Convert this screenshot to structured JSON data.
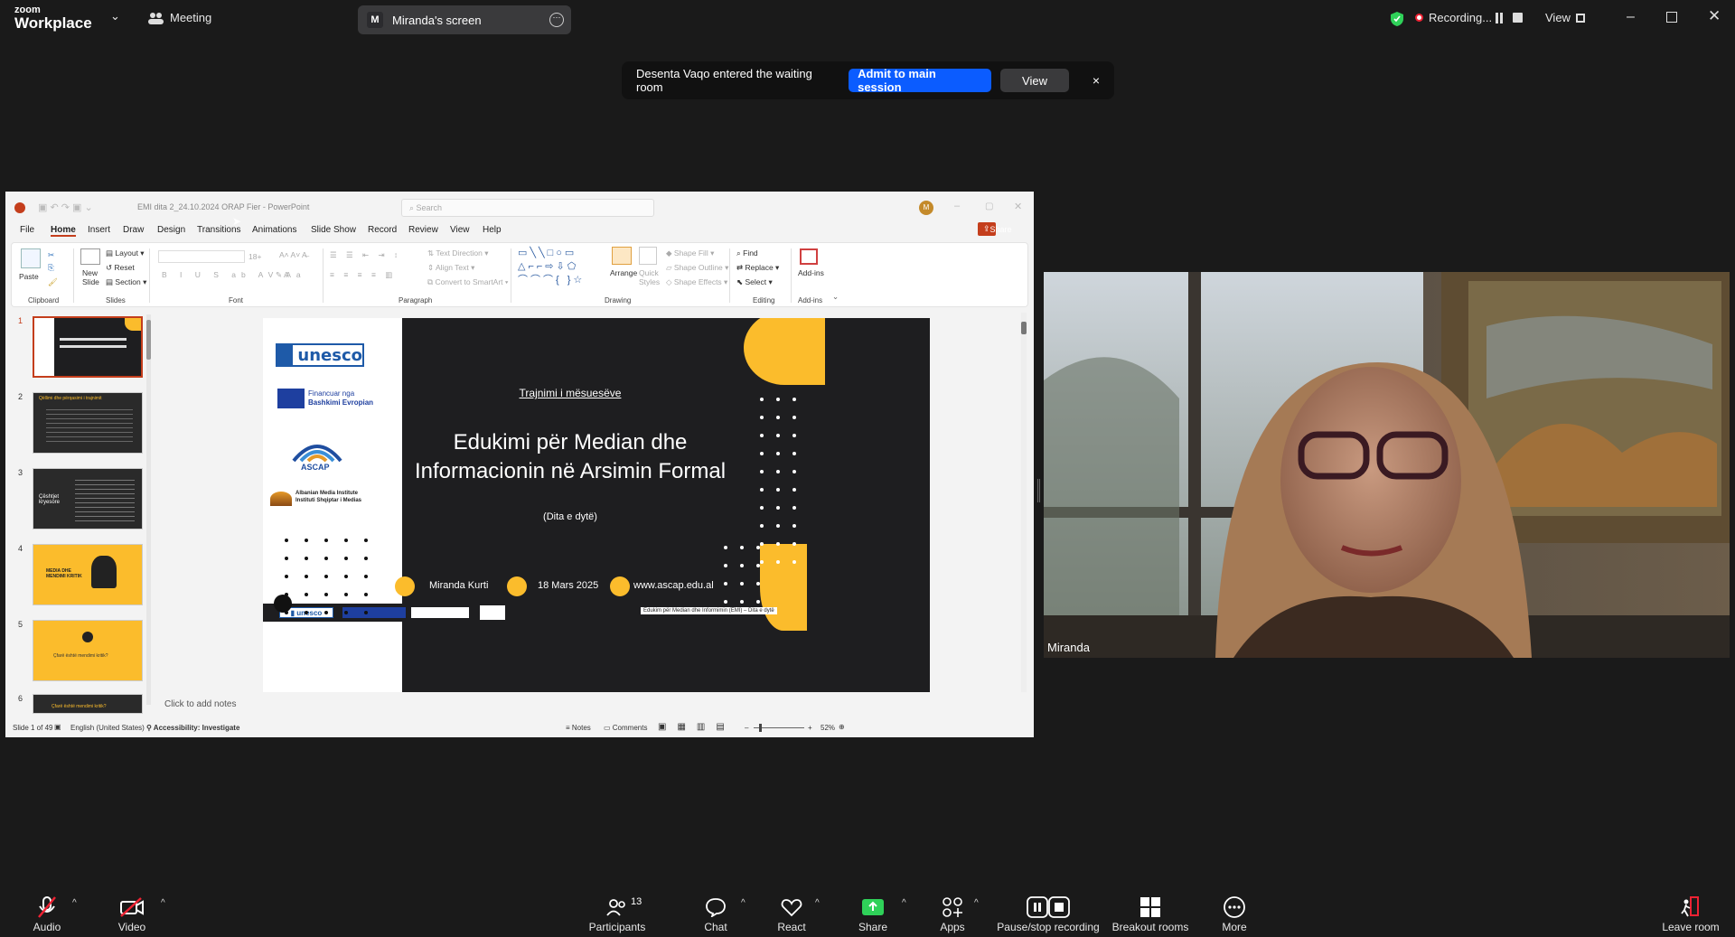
{
  "app": {
    "logo_small": "zoom",
    "logo_big": "Workplace",
    "meeting_label": "Meeting",
    "screen_chip": {
      "initial": "M",
      "label": "Miranda's screen"
    },
    "recording_label": "Recording...",
    "view_label": "View"
  },
  "notification": {
    "message": "Desenta Vaqo entered the waiting room",
    "admit_label": "Admit to main session",
    "view_label": "View",
    "close": "×"
  },
  "ppt": {
    "title": "EMI dita 2_24.10.2024 ORAP Fier  -  PowerPoint",
    "search_placeholder": "Search",
    "account_initial": "M",
    "share_label": "Share",
    "tabs": [
      "File",
      "Home",
      "Insert",
      "Draw",
      "Design",
      "Transitions",
      "Animations",
      "Slide Show",
      "Record",
      "Review",
      "View",
      "Help"
    ],
    "ribbon": {
      "paste": "Paste",
      "clipboard": "Clipboard",
      "new_slide": "New Slide",
      "layout": "Layout",
      "reset": "Reset",
      "section": "Section",
      "slides": "Slides",
      "font_size": "18+",
      "font": "Font",
      "text_direction": "Text Direction",
      "align_text": "Align Text",
      "convert_smartart": "Convert to SmartArt",
      "paragraph": "Paragraph",
      "arrange": "Arrange",
      "quick_styles": "Quick Styles",
      "shape_fill": "Shape Fill",
      "shape_outline": "Shape Outline",
      "shape_effects": "Shape Effects",
      "drawing": "Drawing",
      "find": "Find",
      "replace": "Replace",
      "select": "Select",
      "editing": "Editing",
      "addins": "Add-ins",
      "addins_group": "Add-ins"
    },
    "thumbnails": [
      {
        "num": "1"
      },
      {
        "num": "2",
        "title": "Qëllimi dhe përqasimi i trajnimit"
      },
      {
        "num": "3",
        "title": "Çështjet kryesore"
      },
      {
        "num": "4",
        "title": "MEDIA DHE MENDIMI KRITIK"
      },
      {
        "num": "5",
        "title": "Çfarë është mendimi kritik?"
      },
      {
        "num": "6",
        "title": "Çfarë është mendimi kritik?"
      }
    ],
    "slide": {
      "subtitle_top": "Trajnimi i mësuesëve",
      "title_line1": "Edukimi për Median dhe",
      "title_line2": "Informacionin në Arsimin Formal",
      "day": "(Dita e dytë)",
      "presenter": "Miranda Kurti",
      "date": "18 Mars 2025",
      "website": "www.ascap.edu.al",
      "footer_caption": "Edukim për Median dhe Informimin (EMI) – Dita e dytë",
      "logos": {
        "unesco": "unesco",
        "eu_line1": "Financuar nga",
        "eu_line2": "Bashkimi Evropian",
        "ascap": "ASCAP",
        "ami_line1": "Albanian Media Institute",
        "ami_line2": "Instituti Shqiptar i Medias"
      }
    },
    "notes_placeholder": "Click to add notes",
    "status": {
      "slide_count": "Slide 1 of 49",
      "language": "English (United States)",
      "accessibility": "Accessibility: Investigate",
      "notes": "Notes",
      "comments": "Comments",
      "zoom": "52%"
    }
  },
  "video": {
    "participant_name": "Miranda"
  },
  "toolbar": {
    "audio": "Audio",
    "video": "Video",
    "participants": "Participants",
    "participant_count": "13",
    "chat": "Chat",
    "react": "React",
    "share": "Share",
    "apps": "Apps",
    "pause_stop": "Pause/stop recording",
    "breakout": "Breakout rooms",
    "more": "More",
    "leave": "Leave room"
  },
  "colors": {
    "zoom_blue": "#0b5cff",
    "share_green": "#2fd159",
    "slide_yellow": "#fbbc2c",
    "ppt_share": "#c43e1c"
  }
}
